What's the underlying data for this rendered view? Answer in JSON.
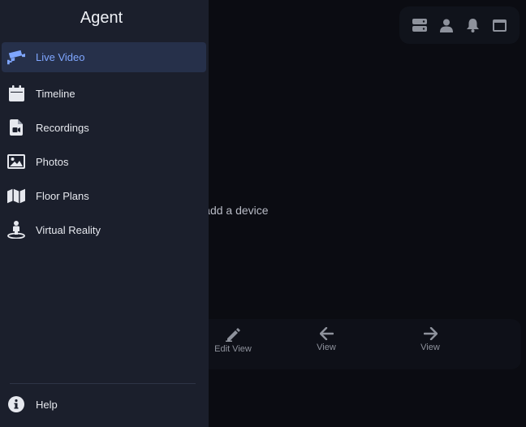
{
  "app": {
    "title": "Agent"
  },
  "sidebar": {
    "items": [
      {
        "label": "Live Video",
        "icon": "video-camera-icon",
        "active": true
      },
      {
        "label": "Timeline",
        "icon": "calendar-icon"
      },
      {
        "label": "Recordings",
        "icon": "file-video-icon"
      },
      {
        "label": "Photos",
        "icon": "image-icon"
      },
      {
        "label": "Floor Plans",
        "icon": "map-icon"
      },
      {
        "label": "Virtual Reality",
        "icon": "vr-person-icon"
      }
    ],
    "help_label": "Help"
  },
  "main": {
    "empty_message": "Edit this view to add a device",
    "bottom": {
      "edit_label": "Edit View",
      "prev_label": "View",
      "next_label": "View"
    }
  },
  "colors": {
    "accent": "#7fa6ff",
    "sidebar": "#1b1f2c",
    "background": "#0b0c12"
  }
}
